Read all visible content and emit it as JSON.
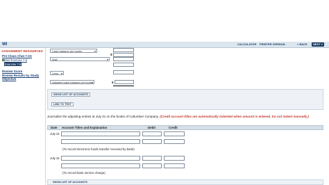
{
  "toolbar": {
    "logo": "WI",
    "calculator": "CALCULATOR",
    "printer": "PRINTER VERSION",
    "back": "« BACK",
    "next": "NEXT »"
  },
  "sidebar": {
    "header": "ASSIGNMENT RESOURCES",
    "chapter": "Pre-Class Chat 7-2A",
    "items": [
      {
        "label": "Brief Exercise 7-8",
        "checked": true
      },
      {
        "label": "Exercise 7-9",
        "selected": true
      }
    ],
    "review_score": "Review Score",
    "review_results": "Review Results by Study",
    "review_results_2": "Objective"
  },
  "recon": {
    "cash_balance_label": "Cash balance per books",
    "add_label": "Add: ",
    "less_label": "Less: ",
    "adjusted_label": "Adjusted cash balance per books",
    "dollar": "$"
  },
  "buttons": {
    "show_list": "SHOW LIST OF ACCOUNTS",
    "link_to_text": "LINK TO TEXT",
    "show_list_2": "SHOW LIST OF ACCOUNTS"
  },
  "instructions": {
    "text": "Journalize the adjusting entries at July 31 on the books of Cullumber Company. ",
    "red_text": "(Credit account titles are automatically indented when amount is entered. Do not indent manually.)"
  },
  "journal": {
    "headers": {
      "date": "Date",
      "account": "Account Titles and Explanation",
      "debit": "Debit",
      "credit": "Credit"
    },
    "entries": [
      {
        "date": "July 31",
        "note": "(To record electronic funds transfer received by bank)"
      },
      {
        "date": "July 31",
        "note": "(To record bank service charge)"
      }
    ]
  }
}
